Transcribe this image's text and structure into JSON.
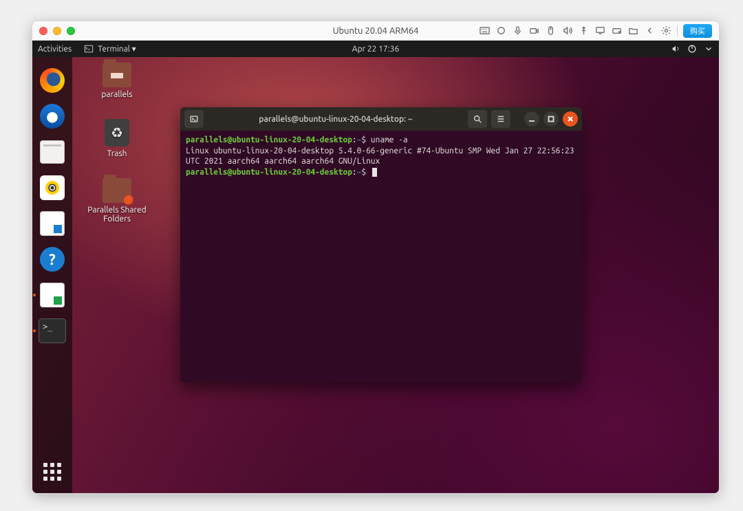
{
  "mac": {
    "title": "Ubuntu 20.04 ARM64",
    "buy": "购买"
  },
  "ubuntu": {
    "activities": "Activities",
    "appmenu": "Terminal ▾",
    "clock": "Apr 22  17:36"
  },
  "dock": {
    "firefox": "Firefox",
    "thunderbird": "Thunderbird",
    "files": "Files",
    "rhythmbox": "Rhythmbox",
    "writer": "LibreOffice Writer",
    "help": "Help",
    "calc": "LibreOffice Calc",
    "terminal": "Terminal",
    "apps": "Show Applications"
  },
  "desktop": {
    "home": "parallels",
    "trash": "Trash",
    "shared": "Parallels Shared Folders"
  },
  "terminal": {
    "title": "parallels@ubuntu-linux-20-04-desktop: ~",
    "prompt_user": "parallels@ubuntu-linux-20-04-desktop",
    "prompt_path": "~",
    "prompt_suffix": "$",
    "cmd1": "uname -a",
    "out1": "Linux ubuntu-linux-20-04-desktop 5.4.0-66-generic #74-Ubuntu SMP Wed Jan 27 22:56:23 UTC 2021 aarch64 aarch64 aarch64 GNU/Linux"
  }
}
